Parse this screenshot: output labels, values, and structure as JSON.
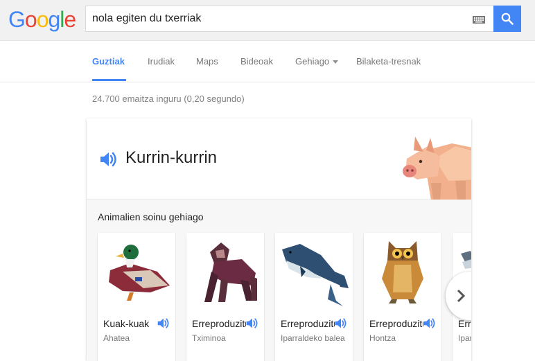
{
  "logo": {
    "letters": [
      "G",
      "o",
      "o",
      "g",
      "l",
      "e"
    ],
    "colors": [
      "#4285f4",
      "#ea4335",
      "#fbbc05",
      "#4285f4",
      "#34a853",
      "#ea4335"
    ]
  },
  "search": {
    "query": "nola egiten du txerriak",
    "keyboard_icon": "keyboard-icon",
    "button_icon": "search-icon"
  },
  "tabs": [
    {
      "label": "Guztiak",
      "active": true
    },
    {
      "label": "Irudiak"
    },
    {
      "label": "Maps"
    },
    {
      "label": "Bideoak"
    },
    {
      "label": "Gehiago"
    },
    {
      "label": "Bilaketa-tresnak"
    }
  ],
  "stats": "24.700 emaitza inguru (0,20 segundo)",
  "card": {
    "sound": "Kurrin-kurrin",
    "speaker_icon": "speaker-icon",
    "image": "pig-illustration",
    "more_title": "Animalien soinu gehiago",
    "animals": [
      {
        "sound": "Kuak-kuak",
        "name": "Ahatea",
        "image": "duck-illustration"
      },
      {
        "sound": "Erreproduzitu",
        "name": "Tximinoa",
        "image": "gorilla-illustration"
      },
      {
        "sound": "Erreproduzitu",
        "name": "Iparraldeko balea",
        "image": "whale-illustration"
      },
      {
        "sound": "Erreproduzitu",
        "name": "Hontza",
        "image": "owl-illustration"
      },
      {
        "sound": "Erreproduzitu",
        "name": "Iparraldeko",
        "image": "animal-illustration"
      }
    ],
    "next_icon": "chevron-right-icon"
  },
  "colors": {
    "accent": "#4285f4",
    "text": "#222222",
    "muted": "#777777"
  }
}
